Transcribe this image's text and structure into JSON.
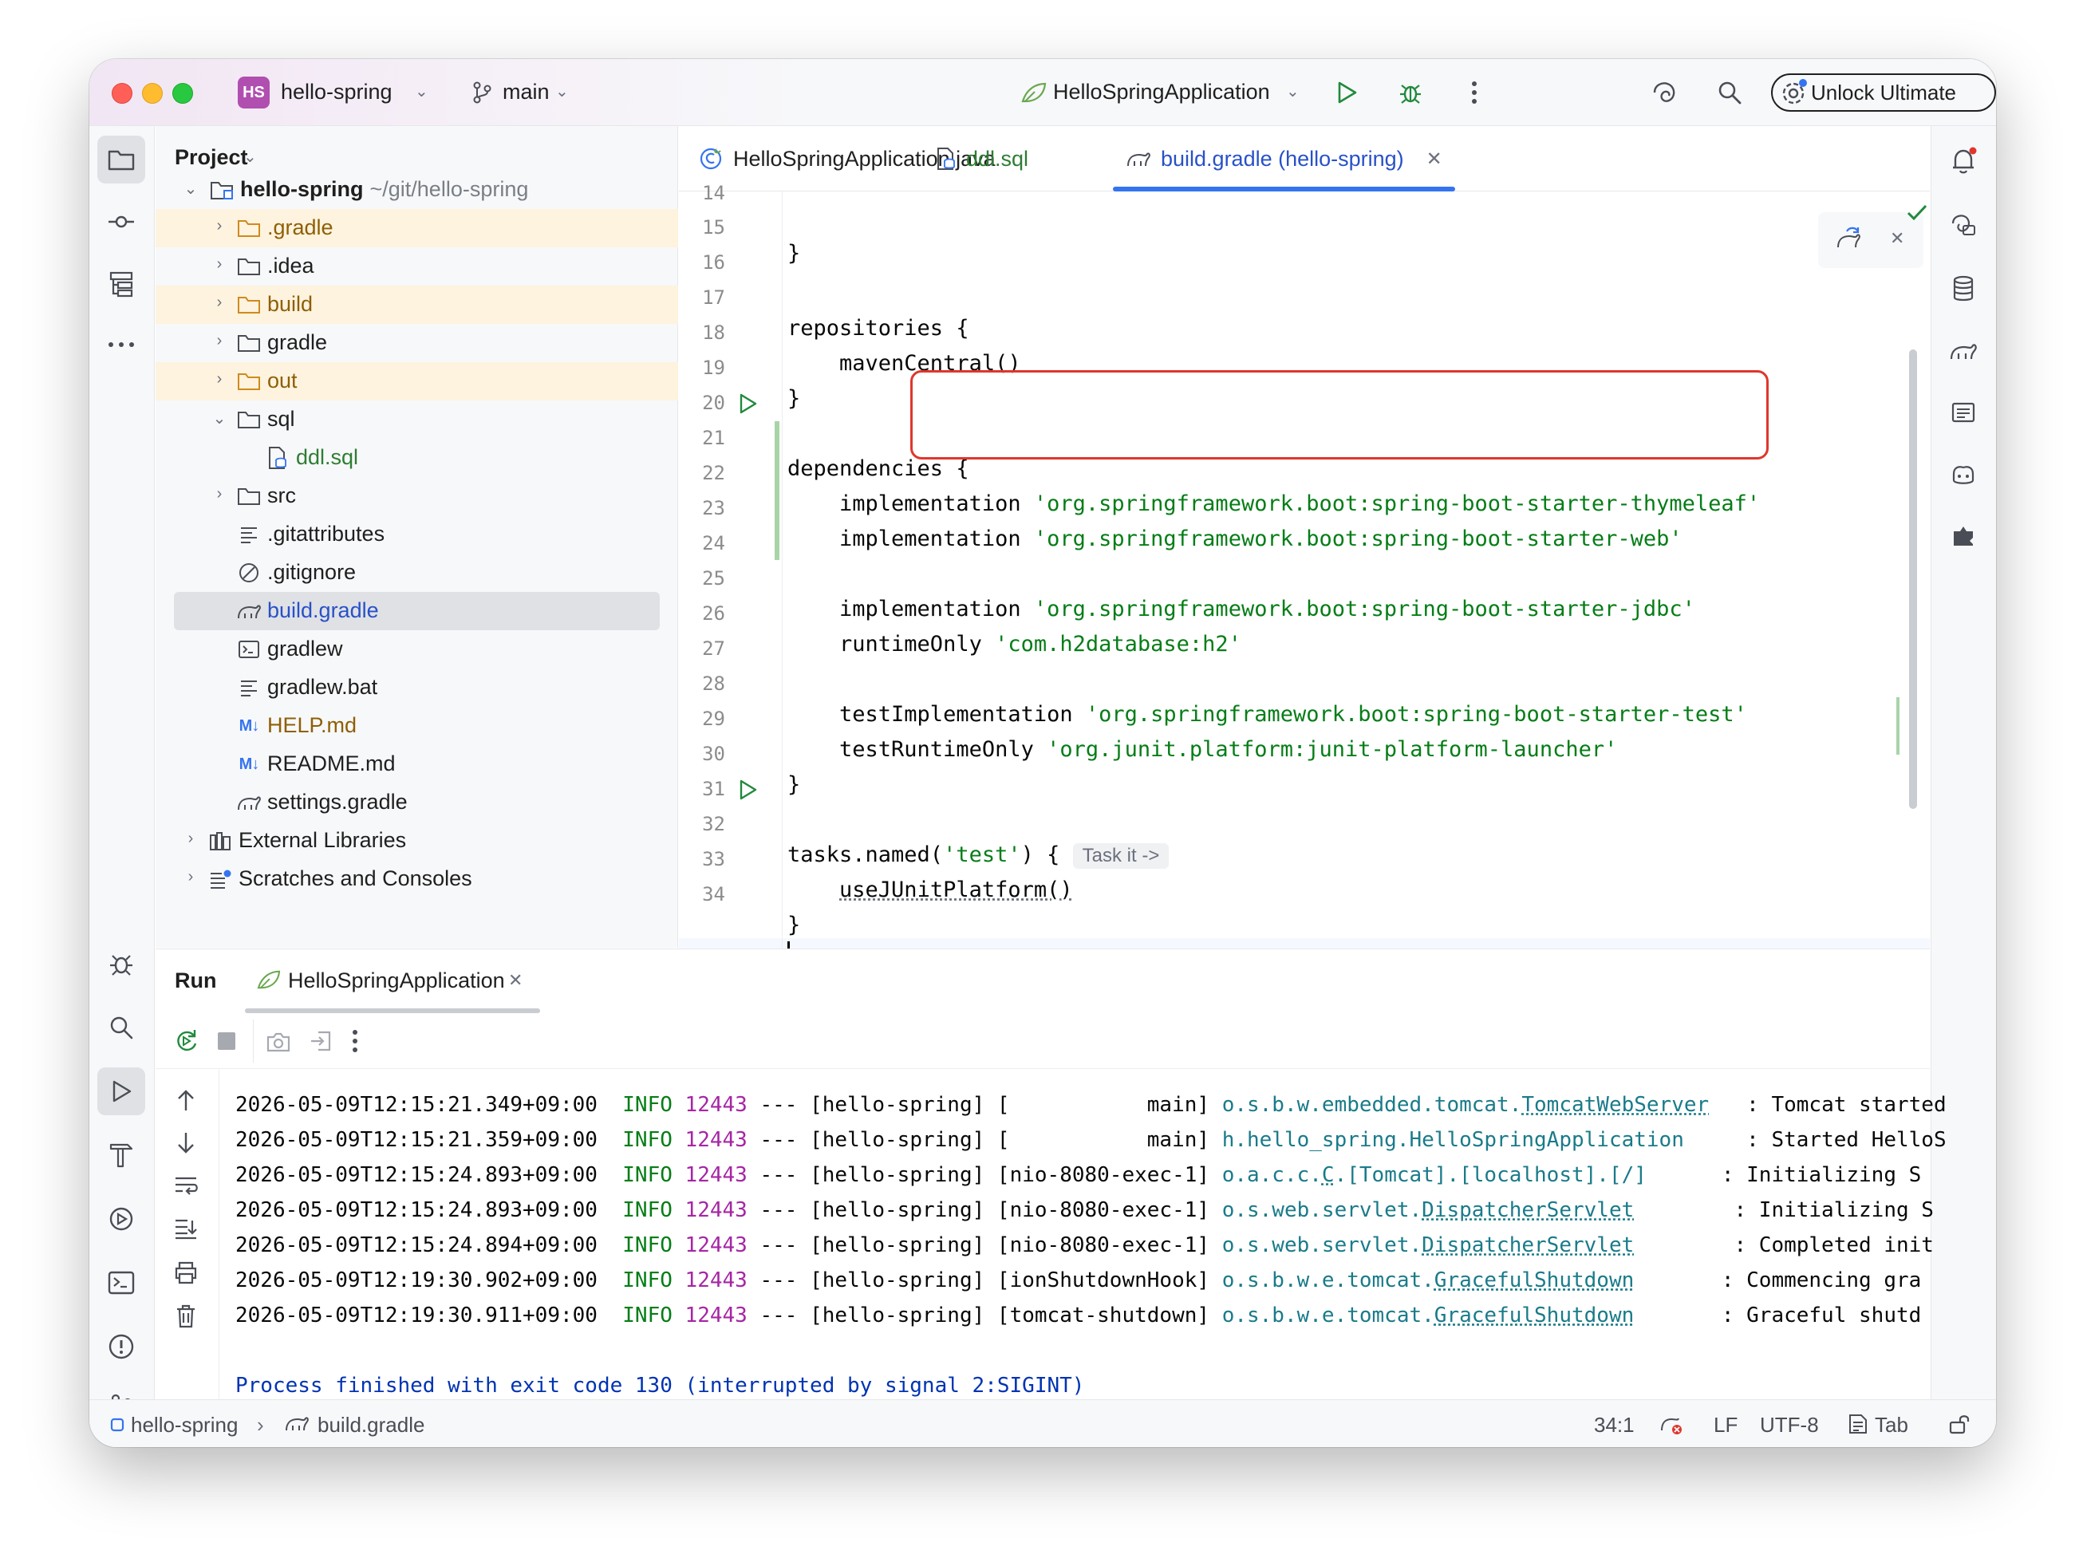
{
  "titlebar": {
    "project_badge": "HS",
    "project_name": "hello-spring",
    "branch": "main",
    "run_config": "HelloSpringApplication",
    "unlock_label": "Unlock Ultimate"
  },
  "project_panel": {
    "title": "Project",
    "root_name": "hello-spring",
    "root_path": "~/git/hello-spring",
    "items": [
      {
        "label": ".gradle"
      },
      {
        "label": ".idea"
      },
      {
        "label": "build"
      },
      {
        "label": "gradle"
      },
      {
        "label": "out"
      },
      {
        "label": "sql"
      },
      {
        "label": "ddl.sql"
      },
      {
        "label": "src"
      },
      {
        "label": ".gitattributes"
      },
      {
        "label": ".gitignore"
      },
      {
        "label": "build.gradle"
      },
      {
        "label": "gradlew"
      },
      {
        "label": "gradlew.bat"
      },
      {
        "label": "HELP.md"
      },
      {
        "label": "README.md"
      },
      {
        "label": "settings.gradle"
      },
      {
        "label": "External Libraries"
      },
      {
        "label": "Scratches and Consoles"
      }
    ],
    "md_badge": "M↓"
  },
  "editor": {
    "tabs": [
      {
        "label": "HelloSpringApplication.java"
      },
      {
        "label": "ddl.sql"
      },
      {
        "label": "build.gradle (hello-spring)"
      }
    ],
    "line_numbers": [
      "14",
      "15",
      "16",
      "17",
      "18",
      "19",
      "20",
      "21",
      "22",
      "23",
      "24",
      "25",
      "26",
      "27",
      "28",
      "29",
      "30",
      "31",
      "32",
      "33",
      "34"
    ],
    "code": {
      "l14": "}",
      "l16": "repositories {",
      "l17": "    mavenCentral()",
      "l18": "}",
      "l20": "dependencies {",
      "l21_kw": "    implementation ",
      "l21_str": "'org.springframework.boot:spring-boot-starter-thymeleaf'",
      "l22_kw": "    implementation ",
      "l22_str": "'org.springframework.boot:spring-boot-starter-web'",
      "l24_kw": "    implementation ",
      "l24_str": "'org.springframework.boot:spring-boot-starter-jdbc'",
      "l25_kw": "    runtimeOnly ",
      "l25_str": "'com.h2database:h2'",
      "l27_kw": "    testImplementation ",
      "l27_str": "'org.springframework.boot:spring-boot-starter-test'",
      "l28_kw": "    testRuntimeOnly ",
      "l28_str": "'org.junit.platform:junit-platform-launcher'",
      "l29": "}",
      "l31_a": "tasks.named(",
      "l31_str": "'test'",
      "l31_b": ") { ",
      "l31_hint": "Task it ->",
      "l32": "useJUnitPlatform()",
      "l32_indent": "    ",
      "l33": "}"
    }
  },
  "run_panel": {
    "title": "Run",
    "tab_label": "HelloSpringApplication",
    "log": [
      {
        "ts": "2026-05-09T12:15:21.349+09:00",
        "level": "INFO",
        "pid": "12443",
        "sep": " --- ",
        "app": "[hello-spring]",
        "thread": "[           main]",
        "logger_pre": "o.s.b.w.embedded.tomcat.",
        "logger_cls": "TomcatWebServer",
        "msg": ": Tomcat started"
      },
      {
        "ts": "2026-05-09T12:15:21.359+09:00",
        "level": "INFO",
        "pid": "12443",
        "sep": " --- ",
        "app": "[hello-spring]",
        "thread": "[           main]",
        "logger_pre": "h.hello_spring.HelloSpringApplication",
        "logger_cls": "",
        "msg": ": Started HelloS"
      },
      {
        "ts": "2026-05-09T12:15:24.893+09:00",
        "level": "INFO",
        "pid": "12443",
        "sep": " --- ",
        "app": "[hello-spring]",
        "thread": "[nio-8080-exec-1]",
        "logger_pre": "o.a.c.c.",
        "logger_cls": "C",
        "logger_post": ".[Tomcat].[localhost].[/]",
        "msg": ": Initializing S"
      },
      {
        "ts": "2026-05-09T12:15:24.893+09:00",
        "level": "INFO",
        "pid": "12443",
        "sep": " --- ",
        "app": "[hello-spring]",
        "thread": "[nio-8080-exec-1]",
        "logger_pre": "o.s.web.servlet.",
        "logger_cls": "DispatcherServlet",
        "msg": ": Initializing S"
      },
      {
        "ts": "2026-05-09T12:15:24.894+09:00",
        "level": "INFO",
        "pid": "12443",
        "sep": " --- ",
        "app": "[hello-spring]",
        "thread": "[nio-8080-exec-1]",
        "logger_pre": "o.s.web.servlet.",
        "logger_cls": "DispatcherServlet",
        "msg": ": Completed init"
      },
      {
        "ts": "2026-05-09T12:19:30.902+09:00",
        "level": "INFO",
        "pid": "12443",
        "sep": " --- ",
        "app": "[hello-spring]",
        "thread": "[ionShutdownHook]",
        "logger_pre": "o.s.b.w.e.tomcat.",
        "logger_cls": "GracefulShutdown",
        "msg": ": Commencing gra"
      },
      {
        "ts": "2026-05-09T12:19:30.911+09:00",
        "level": "INFO",
        "pid": "12443",
        "sep": " --- ",
        "app": "[hello-spring]",
        "thread": "[tomcat-shutdown]",
        "logger_pre": "o.s.b.w.e.tomcat.",
        "logger_cls": "GracefulShutdown",
        "msg": ": Graceful shutd"
      }
    ],
    "exit_message": "Process finished with exit code 130 (interrupted by signal 2:SIGINT)"
  },
  "statusbar": {
    "crumb_project": "hello-spring",
    "crumb_file": "build.gradle",
    "position": "34:1",
    "line_ending": "LF",
    "encoding": "UTF-8",
    "indent": "Tab"
  },
  "colors": {
    "accent": "#3574f0",
    "string": "#067d17",
    "highlight_box": "#e0362c",
    "project_badge": "#b04fb0"
  }
}
